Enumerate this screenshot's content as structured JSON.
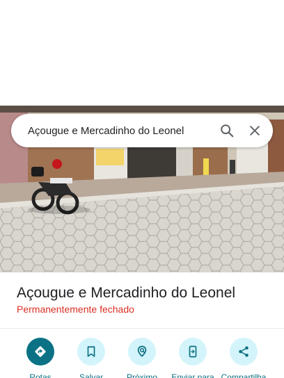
{
  "search": {
    "query": "Açougue e Mercadinho do Leonel",
    "search_icon": "search-icon",
    "close_icon": "close-icon"
  },
  "place": {
    "title": "Açougue e Mercadinho do Leonel",
    "status": "Permanentemente fechado",
    "status_color": "#d93025"
  },
  "actions": [
    {
      "label": "Rotas",
      "icon": "directions-icon"
    },
    {
      "label": "Salvar",
      "icon": "bookmark-icon"
    },
    {
      "label": "Próximo",
      "icon": "nearby-icon"
    },
    {
      "label": "Enviar para",
      "icon": "send-to-phone-icon"
    },
    {
      "label": "Compartilha",
      "icon": "share-icon"
    }
  ],
  "colors": {
    "accent": "#0b7285",
    "action_bg": "#d3f4fb",
    "action_text": "#0b6e80"
  }
}
